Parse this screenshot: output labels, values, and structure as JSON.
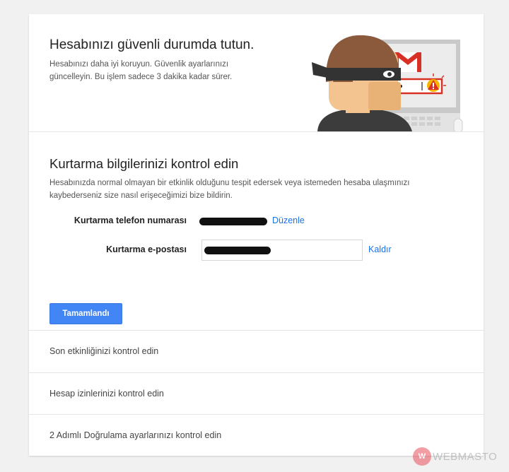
{
  "hero": {
    "title": "Hesabınızı güvenli durumda tutun.",
    "description": "Hesabınızı daha iyi koruyun. Güvenlik ayarlarınızı güncelleyin. Bu işlem sadece 3 dakika kadar sürer."
  },
  "recovery": {
    "title": "Kurtarma bilgilerinizi kontrol edin",
    "description": "Hesabınızda normal olmayan bir etkinlik olduğunu tespit edersek veya istemeden hesaba ulaşmınızı kaybederseniz size nasıl erişeceğimizi bize bildirin.",
    "phone": {
      "label": "Kurtarma telefon numarası",
      "action": "Düzenle"
    },
    "email": {
      "label": "Kurtarma e-postası",
      "action": "Kaldır"
    },
    "done_button": "Tamamlandı"
  },
  "sections": [
    {
      "label": "Son etkinliğinizi kontrol edin"
    },
    {
      "label": "Hesap izinlerinizi kontrol edin"
    },
    {
      "label": "2 Adımlı Doğrulama ayarlarınızı kontrol edin"
    }
  ],
  "watermark": {
    "logo": "W",
    "text": "WEBMASTO"
  },
  "colors": {
    "accent": "#4285f4",
    "link": "#1a73e8",
    "background": "#f1f1f1"
  }
}
